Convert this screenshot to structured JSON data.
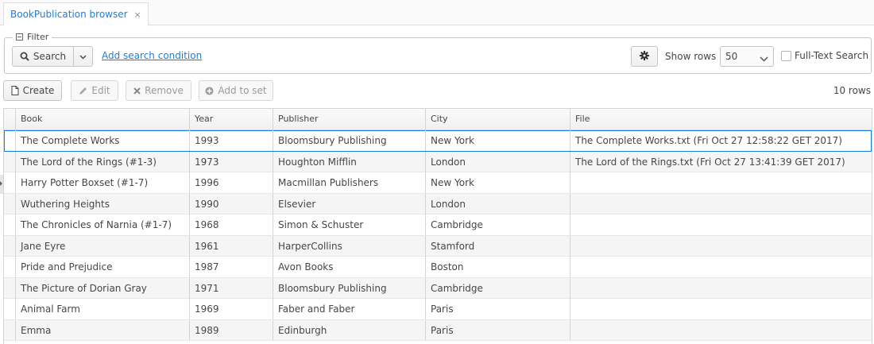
{
  "tab": {
    "label": "BookPublication browser",
    "close": "×"
  },
  "filter": {
    "legend": "Filter",
    "search_label": "Search",
    "add_condition": "Add search condition",
    "show_rows_label": "Show rows",
    "show_rows_value": "50",
    "fulltext_label": "Full-Text Search"
  },
  "toolbar": {
    "create": "Create",
    "edit": "Edit",
    "remove": "Remove",
    "add_to_set": "Add to set",
    "row_count": "10 rows"
  },
  "table": {
    "headers": [
      "Book",
      "Year",
      "Publisher",
      "City",
      "File"
    ],
    "rows": [
      [
        "The Complete Works",
        "1993",
        "Bloomsbury Publishing",
        "New York",
        "The Complete Works.txt (Fri Oct 27 12:58:22 GET 2017)"
      ],
      [
        "The Lord of the Rings (#1-3)",
        "1973",
        "Houghton Mifflin",
        "London",
        "The Lord of the Rings.txt (Fri Oct 27 13:41:39 GET 2017)"
      ],
      [
        "Harry Potter Boxset (#1-7)",
        "1996",
        "Macmillan Publishers",
        "New York",
        ""
      ],
      [
        "Wuthering Heights",
        "1990",
        "Elsevier",
        "London",
        ""
      ],
      [
        "The Chronicles of Narnia (#1-7)",
        "1968",
        "Simon & Schuster",
        "Cambridge",
        ""
      ],
      [
        "Jane Eyre",
        "1961",
        "HarperCollins",
        "Stamford",
        ""
      ],
      [
        "Pride and Prejudice",
        "1987",
        "Avon Books",
        "Boston",
        ""
      ],
      [
        "The Picture of Dorian Gray",
        "1971",
        "Bloomsbury Publishing",
        "Cambridge",
        ""
      ],
      [
        "Animal Farm",
        "1969",
        "Faber and Faber",
        "Paris",
        ""
      ],
      [
        "Emma",
        "1989",
        "Edinburgh",
        "Paris",
        ""
      ]
    ]
  },
  "colors": {
    "accent": "#197de1",
    "border": "#c5c5c5"
  },
  "icons": {
    "search": "search-icon",
    "gear": "gear-icon",
    "create": "document-icon",
    "edit": "pencil-icon",
    "remove": "x-icon",
    "add_to_set": "plus-circle-icon"
  }
}
